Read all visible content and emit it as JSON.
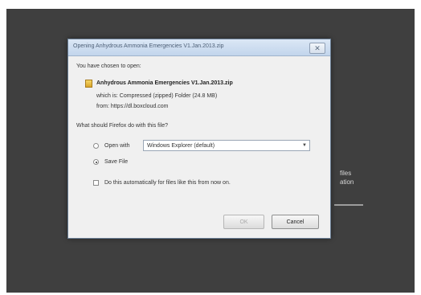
{
  "background": {
    "side_text": [
      "files",
      "ation"
    ]
  },
  "dialog": {
    "title": "Opening Anhydrous Ammonia Emergencies V1.Jan.2013.zip",
    "close_symbol": "✕",
    "intro": "You have chosen to open:",
    "file_name": "Anhydrous Ammonia Emergencies V1.Jan.2013.zip",
    "which_is": "which is: Compressed (zipped) Folder (24.8 MB)",
    "from": "from: https://dl.boxcloud.com",
    "question": "What should Firefox do with this file?",
    "open_with_label": "Open with",
    "open_with_value": "Windows Explorer (default)",
    "save_file_label": "Save File",
    "auto_label": "Do this automatically for files like this from now on.",
    "ok_label": "OK",
    "cancel_label": "Cancel",
    "selected_option": "save_file",
    "icons": {
      "file": "zip-file-icon",
      "dropdown": "chevron-down-icon",
      "close": "close-icon"
    }
  }
}
